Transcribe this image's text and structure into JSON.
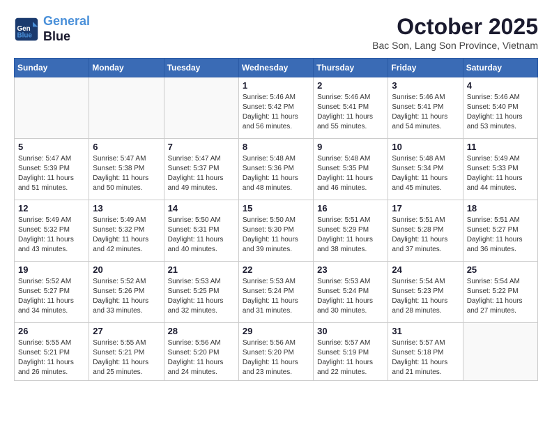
{
  "header": {
    "logo_line1": "General",
    "logo_line2": "Blue",
    "month": "October 2025",
    "location": "Bac Son, Lang Son Province, Vietnam"
  },
  "weekdays": [
    "Sunday",
    "Monday",
    "Tuesday",
    "Wednesday",
    "Thursday",
    "Friday",
    "Saturday"
  ],
  "weeks": [
    [
      {
        "day": "",
        "info": ""
      },
      {
        "day": "",
        "info": ""
      },
      {
        "day": "",
        "info": ""
      },
      {
        "day": "1",
        "info": "Sunrise: 5:46 AM\nSunset: 5:42 PM\nDaylight: 11 hours\nand 56 minutes."
      },
      {
        "day": "2",
        "info": "Sunrise: 5:46 AM\nSunset: 5:41 PM\nDaylight: 11 hours\nand 55 minutes."
      },
      {
        "day": "3",
        "info": "Sunrise: 5:46 AM\nSunset: 5:41 PM\nDaylight: 11 hours\nand 54 minutes."
      },
      {
        "day": "4",
        "info": "Sunrise: 5:46 AM\nSunset: 5:40 PM\nDaylight: 11 hours\nand 53 minutes."
      }
    ],
    [
      {
        "day": "5",
        "info": "Sunrise: 5:47 AM\nSunset: 5:39 PM\nDaylight: 11 hours\nand 51 minutes."
      },
      {
        "day": "6",
        "info": "Sunrise: 5:47 AM\nSunset: 5:38 PM\nDaylight: 11 hours\nand 50 minutes."
      },
      {
        "day": "7",
        "info": "Sunrise: 5:47 AM\nSunset: 5:37 PM\nDaylight: 11 hours\nand 49 minutes."
      },
      {
        "day": "8",
        "info": "Sunrise: 5:48 AM\nSunset: 5:36 PM\nDaylight: 11 hours\nand 48 minutes."
      },
      {
        "day": "9",
        "info": "Sunrise: 5:48 AM\nSunset: 5:35 PM\nDaylight: 11 hours\nand 46 minutes."
      },
      {
        "day": "10",
        "info": "Sunrise: 5:48 AM\nSunset: 5:34 PM\nDaylight: 11 hours\nand 45 minutes."
      },
      {
        "day": "11",
        "info": "Sunrise: 5:49 AM\nSunset: 5:33 PM\nDaylight: 11 hours\nand 44 minutes."
      }
    ],
    [
      {
        "day": "12",
        "info": "Sunrise: 5:49 AM\nSunset: 5:32 PM\nDaylight: 11 hours\nand 43 minutes."
      },
      {
        "day": "13",
        "info": "Sunrise: 5:49 AM\nSunset: 5:32 PM\nDaylight: 11 hours\nand 42 minutes."
      },
      {
        "day": "14",
        "info": "Sunrise: 5:50 AM\nSunset: 5:31 PM\nDaylight: 11 hours\nand 40 minutes."
      },
      {
        "day": "15",
        "info": "Sunrise: 5:50 AM\nSunset: 5:30 PM\nDaylight: 11 hours\nand 39 minutes."
      },
      {
        "day": "16",
        "info": "Sunrise: 5:51 AM\nSunset: 5:29 PM\nDaylight: 11 hours\nand 38 minutes."
      },
      {
        "day": "17",
        "info": "Sunrise: 5:51 AM\nSunset: 5:28 PM\nDaylight: 11 hours\nand 37 minutes."
      },
      {
        "day": "18",
        "info": "Sunrise: 5:51 AM\nSunset: 5:27 PM\nDaylight: 11 hours\nand 36 minutes."
      }
    ],
    [
      {
        "day": "19",
        "info": "Sunrise: 5:52 AM\nSunset: 5:27 PM\nDaylight: 11 hours\nand 34 minutes."
      },
      {
        "day": "20",
        "info": "Sunrise: 5:52 AM\nSunset: 5:26 PM\nDaylight: 11 hours\nand 33 minutes."
      },
      {
        "day": "21",
        "info": "Sunrise: 5:53 AM\nSunset: 5:25 PM\nDaylight: 11 hours\nand 32 minutes."
      },
      {
        "day": "22",
        "info": "Sunrise: 5:53 AM\nSunset: 5:24 PM\nDaylight: 11 hours\nand 31 minutes."
      },
      {
        "day": "23",
        "info": "Sunrise: 5:53 AM\nSunset: 5:24 PM\nDaylight: 11 hours\nand 30 minutes."
      },
      {
        "day": "24",
        "info": "Sunrise: 5:54 AM\nSunset: 5:23 PM\nDaylight: 11 hours\nand 28 minutes."
      },
      {
        "day": "25",
        "info": "Sunrise: 5:54 AM\nSunset: 5:22 PM\nDaylight: 11 hours\nand 27 minutes."
      }
    ],
    [
      {
        "day": "26",
        "info": "Sunrise: 5:55 AM\nSunset: 5:21 PM\nDaylight: 11 hours\nand 26 minutes."
      },
      {
        "day": "27",
        "info": "Sunrise: 5:55 AM\nSunset: 5:21 PM\nDaylight: 11 hours\nand 25 minutes."
      },
      {
        "day": "28",
        "info": "Sunrise: 5:56 AM\nSunset: 5:20 PM\nDaylight: 11 hours\nand 24 minutes."
      },
      {
        "day": "29",
        "info": "Sunrise: 5:56 AM\nSunset: 5:20 PM\nDaylight: 11 hours\nand 23 minutes."
      },
      {
        "day": "30",
        "info": "Sunrise: 5:57 AM\nSunset: 5:19 PM\nDaylight: 11 hours\nand 22 minutes."
      },
      {
        "day": "31",
        "info": "Sunrise: 5:57 AM\nSunset: 5:18 PM\nDaylight: 11 hours\nand 21 minutes."
      },
      {
        "day": "",
        "info": ""
      }
    ]
  ]
}
